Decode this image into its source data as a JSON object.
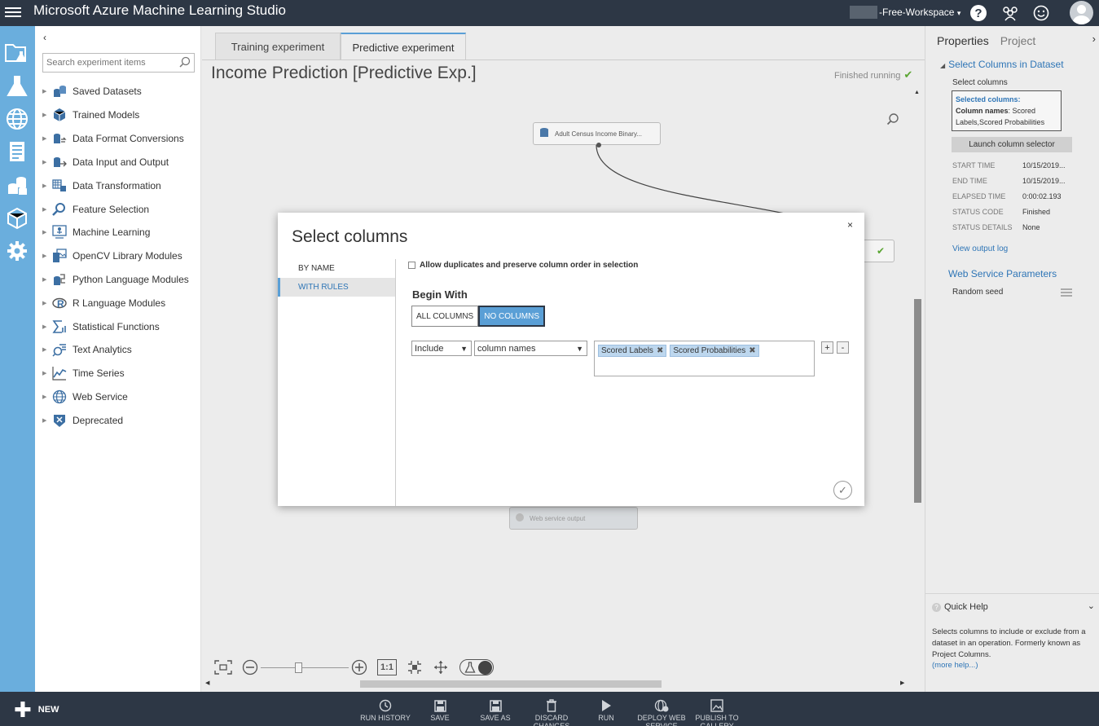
{
  "app": {
    "title": "Microsoft Azure Machine Learning Studio",
    "workspace": "-Free-Workspace",
    "workspace_arrow": "▾"
  },
  "palette": {
    "search_placeholder": "Search experiment items",
    "items": [
      {
        "label": "Saved Datasets",
        "icon": "datasets-icon"
      },
      {
        "label": "Trained Models",
        "icon": "cube-icon"
      },
      {
        "label": "Data Format Conversions",
        "icon": "conversion-icon"
      },
      {
        "label": "Data Input and Output",
        "icon": "io-icon"
      },
      {
        "label": "Data Transformation",
        "icon": "transform-icon"
      },
      {
        "label": "Feature Selection",
        "icon": "magnifier-icon"
      },
      {
        "label": "Machine Learning",
        "icon": "ml-icon"
      },
      {
        "label": "OpenCV Library Modules",
        "icon": "image-icon"
      },
      {
        "label": "Python Language Modules",
        "icon": "python-icon"
      },
      {
        "label": "R Language Modules",
        "icon": "r-icon"
      },
      {
        "label": "Statistical Functions",
        "icon": "sigma-icon"
      },
      {
        "label": "Text Analytics",
        "icon": "text-icon"
      },
      {
        "label": "Time Series",
        "icon": "chart-icon"
      },
      {
        "label": "Web Service",
        "icon": "globe-icon"
      },
      {
        "label": "Deprecated",
        "icon": "deprecated-icon"
      }
    ]
  },
  "canvas": {
    "tabs": [
      "Training experiment",
      "Predictive experiment"
    ],
    "title": "Income Prediction [Predictive Exp.]",
    "status": "Finished running",
    "module_top": "Adult Census Income Binary...",
    "module_output": "Web service output"
  },
  "dialog": {
    "title": "Select columns",
    "close": "×",
    "nav": [
      "BY NAME",
      "WITH RULES"
    ],
    "allow_label": "Allow duplicates and preserve column order in selection",
    "begin_with": "Begin With",
    "all_columns": "ALL COLUMNS",
    "no_columns": "NO COLUMNS",
    "include": "Include",
    "column_names": "column names",
    "tags": [
      "Scored Labels",
      "Scored Probabilities"
    ],
    "plus": "+",
    "minus": "-"
  },
  "properties": {
    "tab_properties": "Properties",
    "tab_project": "Project",
    "section": "Select Columns in Dataset",
    "select_columns": "Select columns",
    "selected_header": "Selected columns:",
    "column_names_label": "Column names",
    "column_names_value": ": Scored Labels,Scored Probabilities",
    "launch": "Launch column selector",
    "rows": [
      {
        "k": "START TIME",
        "v": "10/15/2019..."
      },
      {
        "k": "END TIME",
        "v": "10/15/2019..."
      },
      {
        "k": "ELAPSED TIME",
        "v": "0:00:02.193"
      },
      {
        "k": "STATUS CODE",
        "v": "Finished"
      },
      {
        "k": "STATUS DETAILS",
        "v": "None"
      }
    ],
    "view_log": "View output log",
    "web_params": "Web Service Parameters",
    "random_seed": "Random seed",
    "quick_help": "Quick Help",
    "help_text": "Selects columns to include or exclude from a dataset in an operation. Formerly known as Project Columns.",
    "more_help": "(more help...)"
  },
  "bottombar": {
    "new": "NEW",
    "items": [
      "RUN HISTORY",
      "SAVE",
      "SAVE AS",
      "DISCARD CHANGES",
      "RUN",
      "DEPLOY WEB SERVICE",
      "PUBLISH TO GALLERY"
    ]
  },
  "zoom": {
    "fit": "1:1"
  }
}
